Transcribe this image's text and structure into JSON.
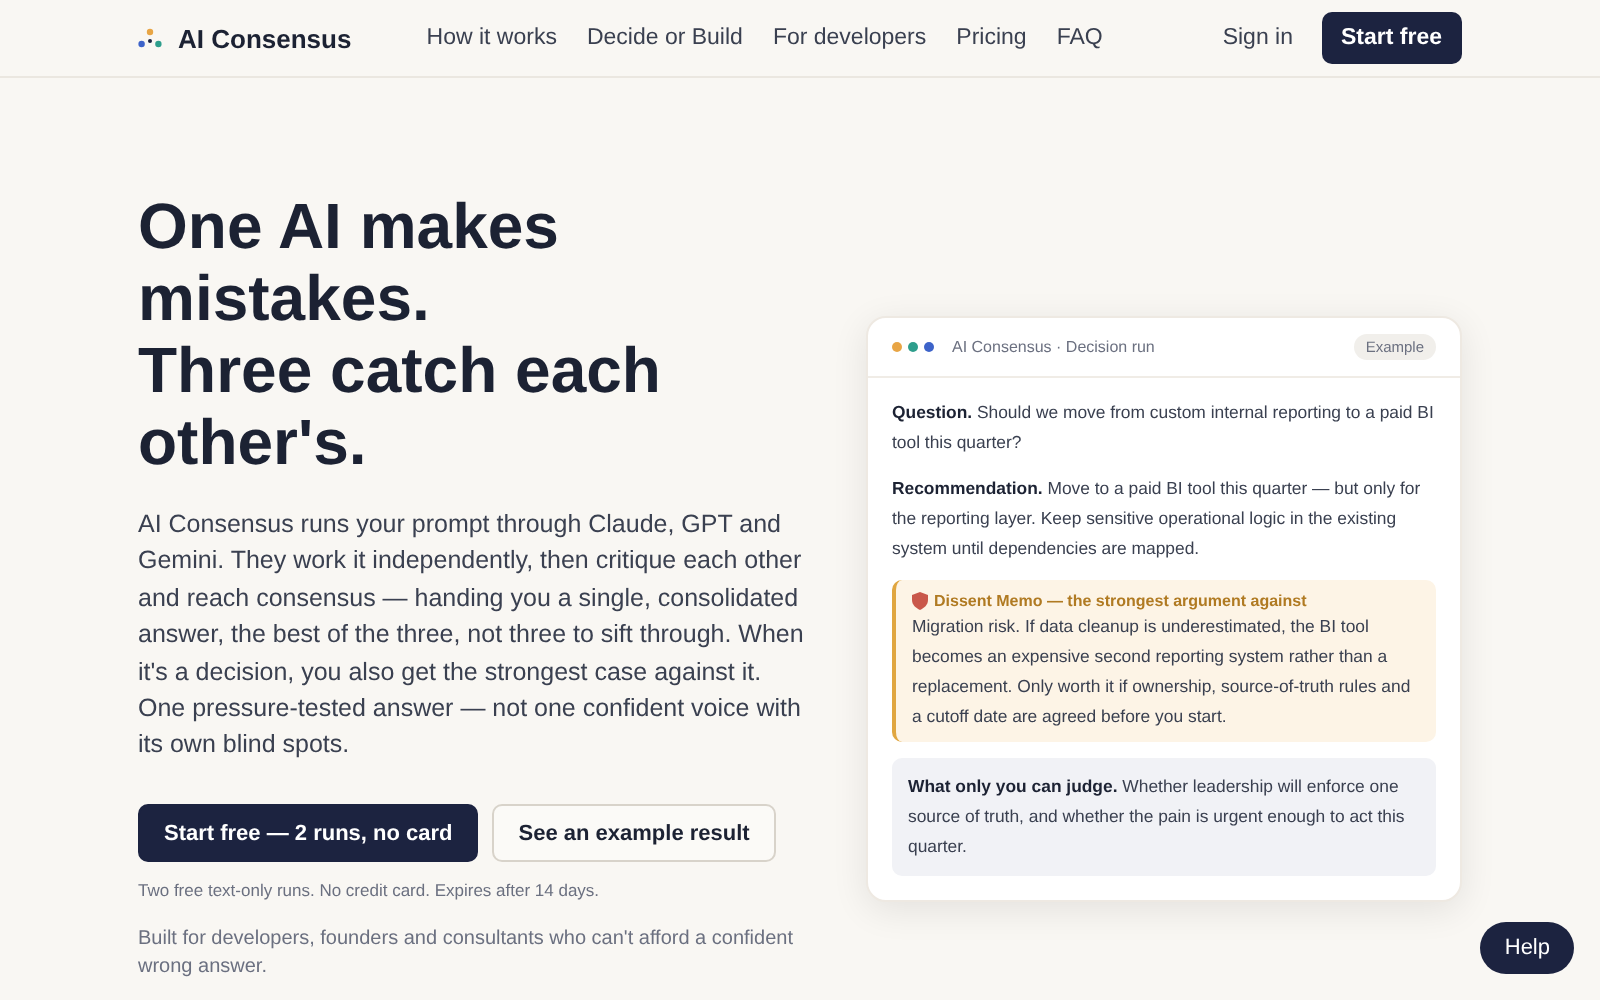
{
  "header": {
    "brand": "AI Consensus",
    "nav": [
      "How it works",
      "Decide or Build",
      "For developers",
      "Pricing",
      "FAQ"
    ],
    "sign_in": "Sign in",
    "cta": "Start free"
  },
  "hero": {
    "title_lines": [
      "One AI makes mistakes.",
      "Three catch each other's."
    ],
    "body": "AI Consensus runs your prompt through Claude, GPT and Gemini. They work it independently, then critique each other and reach consensus — handing you a single, consolidated answer, the best of the three, not three to sift through. When it's a decision, you also get the strongest case against it. One pressure-tested answer — not one confident voice with its own blind spots.",
    "buttons": [
      {
        "label": "Start free — 2 runs, no card",
        "kind": "primary"
      },
      {
        "label": "See an example result",
        "kind": "secondary"
      }
    ],
    "note": "Two free text-only runs. No credit card. Expires after 14 days.",
    "audience": "Built for developers, founders and consultants who can't afford a confident wrong answer."
  },
  "card": {
    "title": "AI Consensus · Decision run",
    "badge": "Example",
    "dots": [
      {
        "color": "#e8a545"
      },
      {
        "color": "#2e9e8c"
      },
      {
        "color": "#3d63c9"
      }
    ],
    "sections": [
      {
        "kind": "plain",
        "text": "**Question.** Should we move from custom internal reporting to a paid BI tool this quarter?"
      },
      {
        "kind": "plain",
        "text": "**Recommendation.** Move to a paid BI tool this quarter — but only for the reporting layer. Keep sensitive operational logic in the existing system until dependencies are mapped."
      },
      {
        "kind": "dissent",
        "heading": "Dissent Memo — the strongest argument against",
        "text": "Migration risk. If data cleanup is underestimated, the BI tool becomes an expensive second reporting system rather than a replacement. Only worth it if ownership, source-of-truth rules and a cutoff date are agreed before you start."
      },
      {
        "kind": "judge",
        "text": "**What only you can judge.** Whether leadership will enforce one source of truth, and whether the pain is urgent enough to act this quarter."
      }
    ]
  },
  "help": "Help"
}
